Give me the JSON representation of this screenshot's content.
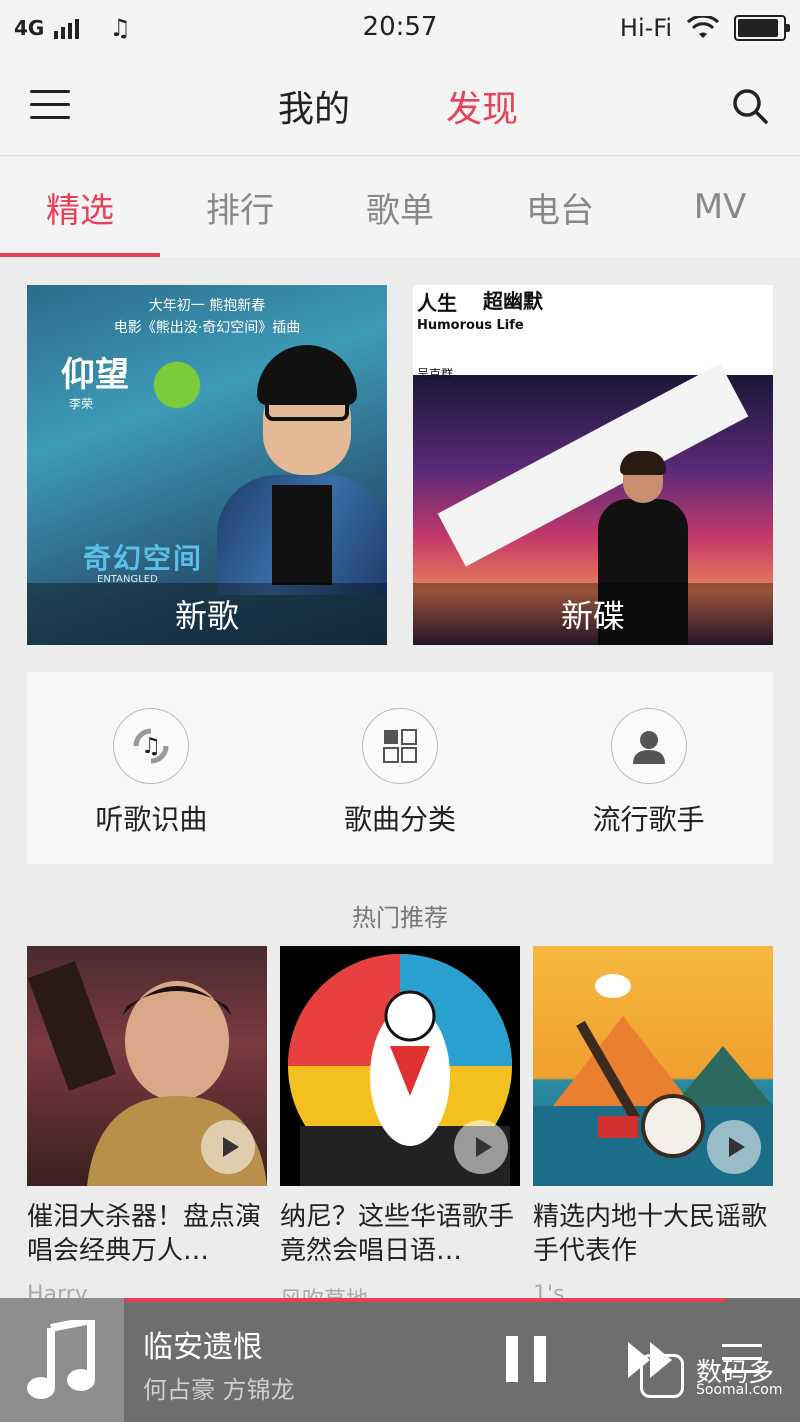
{
  "status_bar": {
    "network": "4G",
    "time": "20:57",
    "hifi": "Hi-Fi",
    "music_note": "♫",
    "battery_level": 0.9
  },
  "header": {
    "tab_mine": "我的",
    "tab_discover": "发现",
    "accent_color": "#e8405a"
  },
  "subtabs": [
    "精选",
    "排行",
    "歌单",
    "电台",
    "MV"
  ],
  "banners": {
    "left": {
      "label": "新歌",
      "line1": "大年初一 熊抱新春",
      "line2": "电影《熊出没·奇幻空间》插曲",
      "title": "仰望",
      "subtitle": "李荣",
      "footer": "奇幻空间",
      "footer_en": "ENTANGLED"
    },
    "right": {
      "label": "新碟",
      "top1": "人生",
      "top2": "超幽默",
      "english": "Humorous Life",
      "artist": "吴克群"
    }
  },
  "quick_actions": [
    {
      "label": "听歌识曲",
      "icon": "music-recognition-icon"
    },
    {
      "label": "歌曲分类",
      "icon": "category-grid-icon"
    },
    {
      "label": "流行歌手",
      "icon": "singer-person-icon"
    }
  ],
  "hot": {
    "title": "热门推荐",
    "cards": [
      {
        "title": "催泪大杀器！盘点演唱会经典万人…",
        "sub": "Harry"
      },
      {
        "title": "纳尼？这些华语歌手竟然会唱日语…",
        "sub": "风吹草地"
      },
      {
        "title": "精选内地十大民谣歌手代表作",
        "sub": "1's"
      }
    ]
  },
  "player": {
    "song": "临安遗恨",
    "artist": "何占豪 方锦龙",
    "progress": 1.0
  },
  "watermark": {
    "main": "数码多",
    "sub": "Soomal.com"
  }
}
